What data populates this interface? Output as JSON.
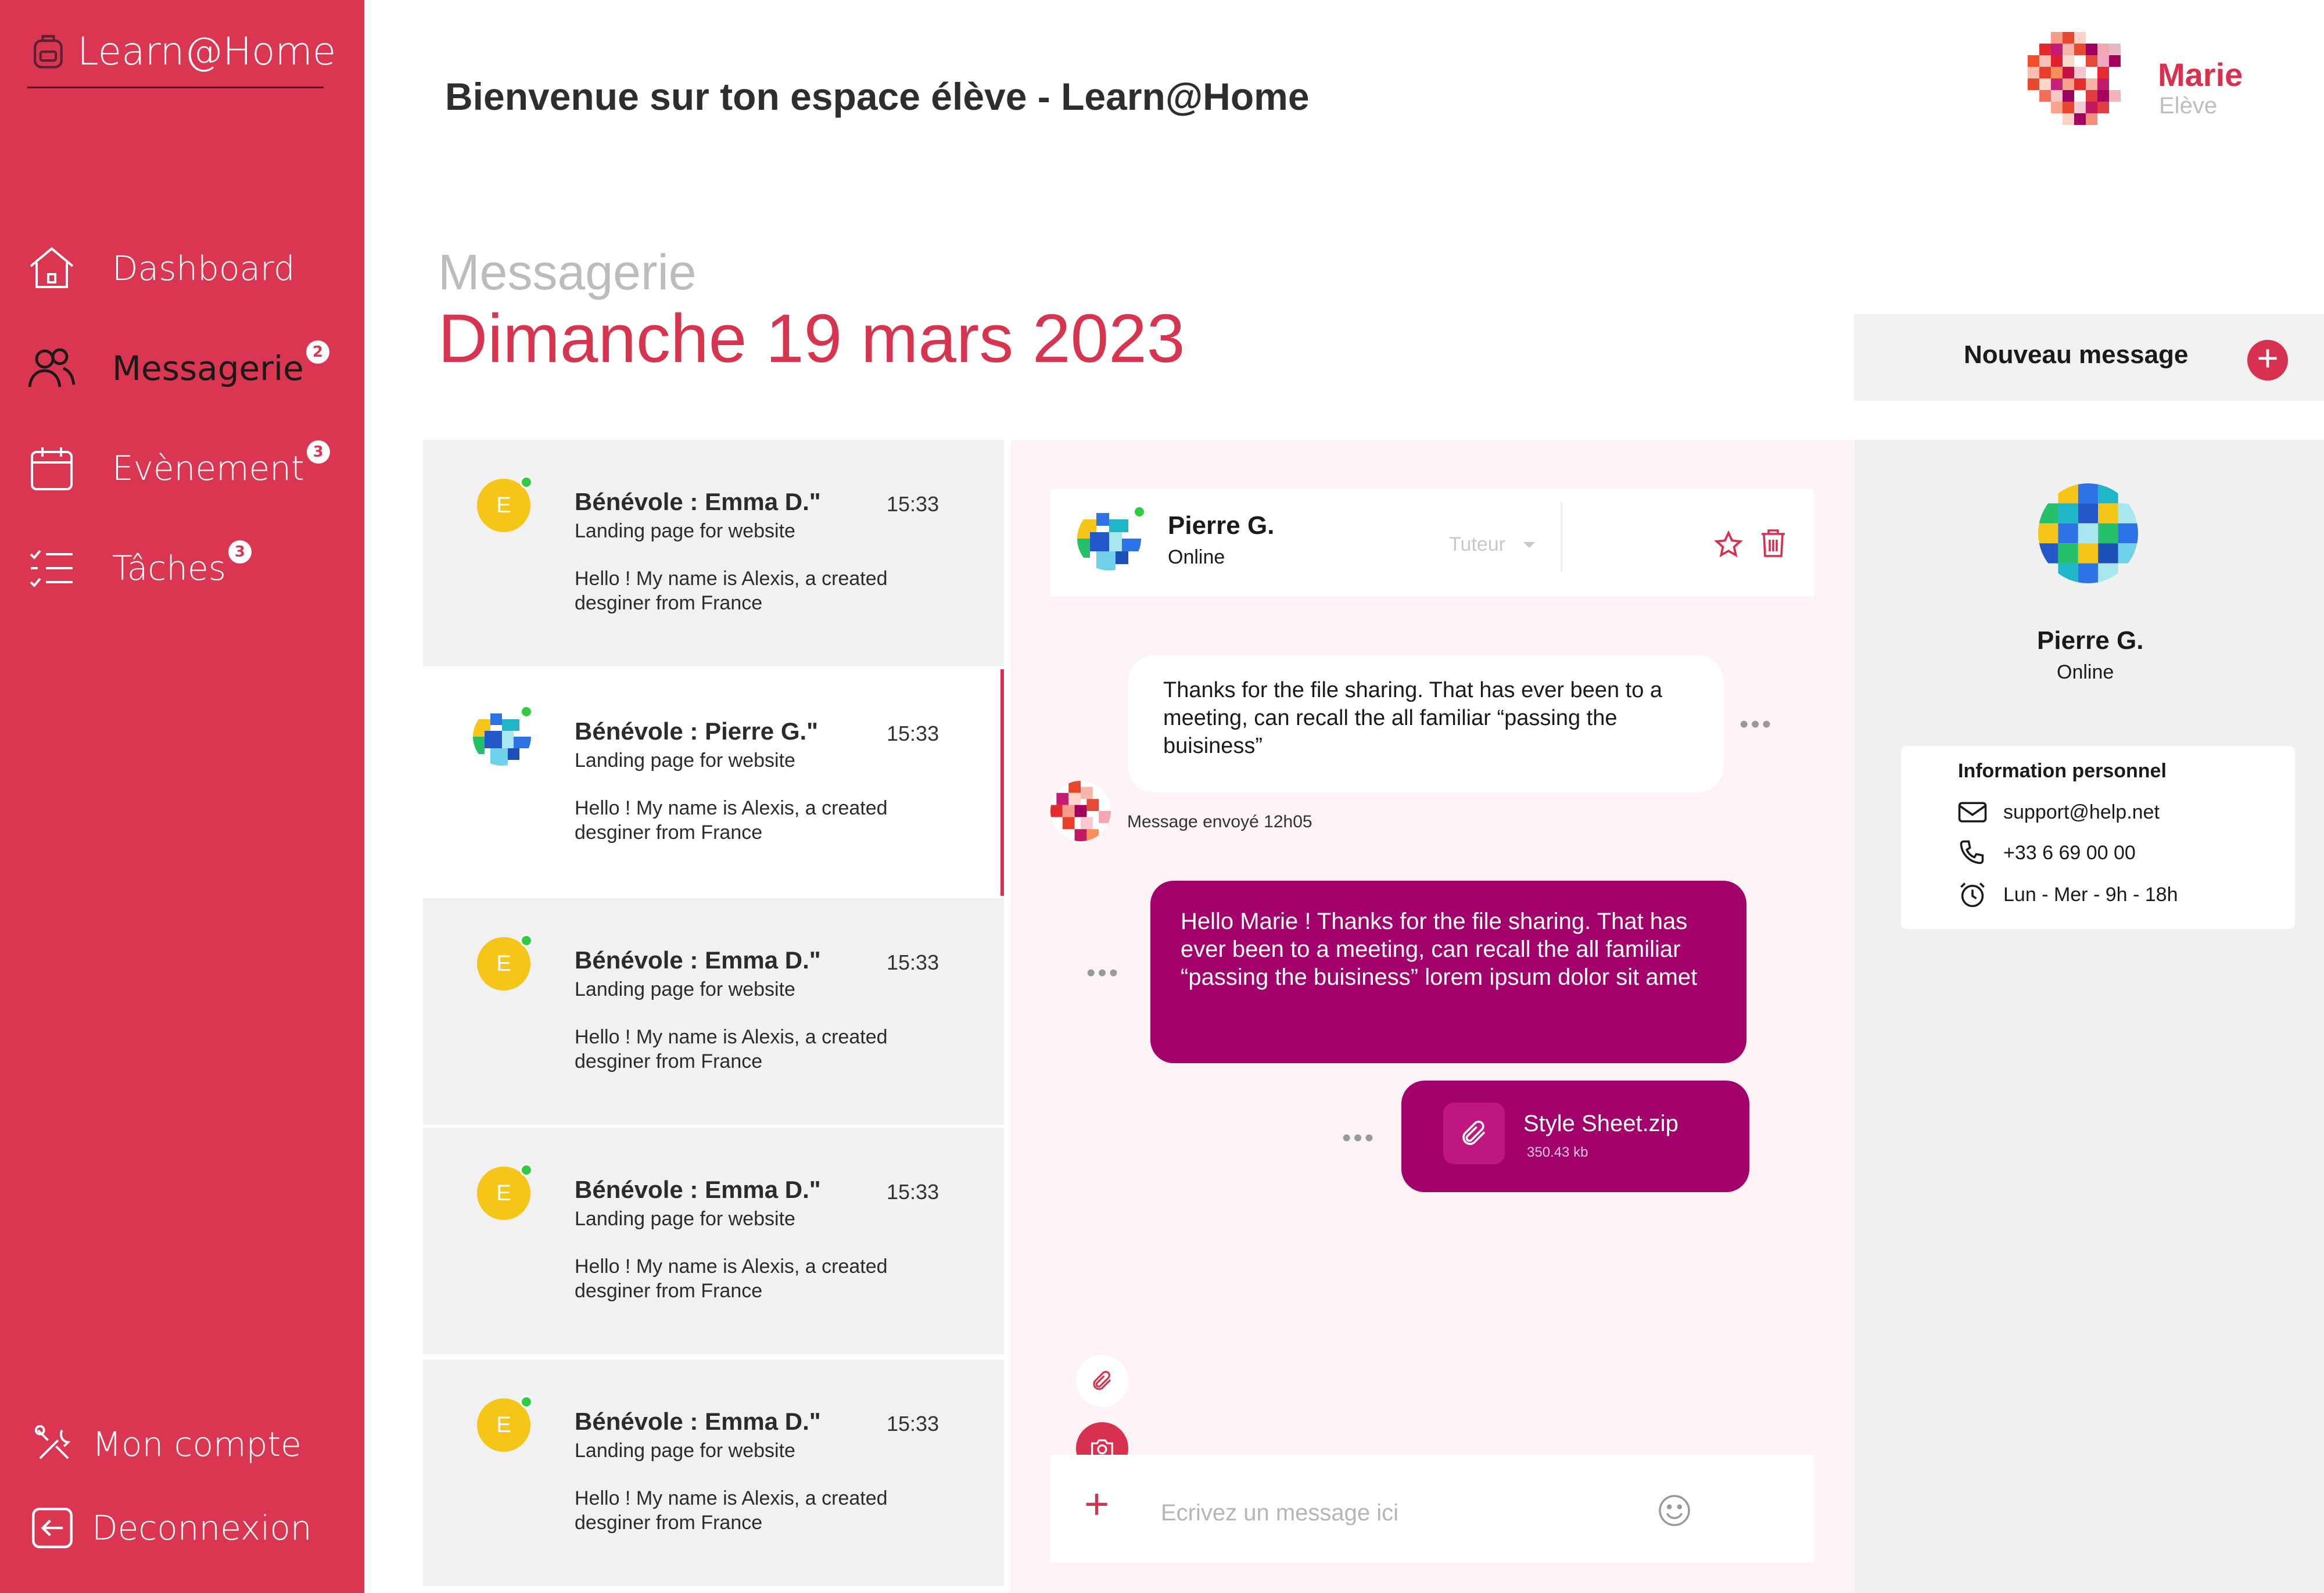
{
  "sidebar": {
    "brand": "Learn@Home",
    "items": [
      {
        "label": "Dashboard",
        "badge": ""
      },
      {
        "label": "Messagerie",
        "badge": "2"
      },
      {
        "label": "Evènement",
        "badge": "3"
      },
      {
        "label": "Tâches",
        "badge": "3"
      }
    ],
    "footer": [
      {
        "label": "Mon compte"
      },
      {
        "label": "Deconnexion"
      }
    ]
  },
  "header": {
    "title": "Bienvenue sur ton espace élève - Learn@Home",
    "user_name": "Marie",
    "user_role": "Elève"
  },
  "page": {
    "section": "Messagerie",
    "date": "Dimanche 19 mars 2023",
    "new_message": "Nouveau message"
  },
  "conversations": [
    {
      "initial": "E",
      "name": "Bénévole : Emma D.\"",
      "time": "15:33",
      "subject": "Landing page for website",
      "preview": "Hello ! My name is Alexis, a created desginer from France"
    },
    {
      "initial": "",
      "name": "Bénévole : Pierre G.\"",
      "time": "15:33",
      "subject": "Landing page for website",
      "preview": "Hello ! My name is Alexis, a created desginer from France"
    },
    {
      "initial": "E",
      "name": "Bénévole : Emma D.\"",
      "time": "15:33",
      "subject": "Landing page for website",
      "preview": "Hello ! My name is Alexis, a created desginer from France"
    },
    {
      "initial": "E",
      "name": "Bénévole : Emma D.\"",
      "time": "15:33",
      "subject": "Landing page for website",
      "preview": "Hello ! My name is Alexis, a created desginer from France"
    },
    {
      "initial": "E",
      "name": "Bénévole : Emma D.\"",
      "time": "15:33",
      "subject": "Landing page for website",
      "preview": "Hello ! My name is Alexis, a created desginer from France"
    }
  ],
  "chat": {
    "contact_name": "Pierre G.",
    "contact_status": "Online",
    "role_select": "Tuteur",
    "incoming": "Thanks for the file sharing. That has ever been to a meeting, can recall the all familiar “passing the buisiness”",
    "sent_info": "Message envoyé 12h05",
    "outgoing": "Hello Marie ! Thanks for the file sharing. That has ever been to a meeting, can recall the all familiar “passing the buisiness” lorem ipsum dolor sit amet",
    "file_name": "Style Sheet.zip",
    "file_size": "350.43 kb",
    "input_placeholder": "Ecrivez un message ici"
  },
  "profile": {
    "name": "Pierre G.",
    "status": "Online",
    "info_title": "Information personnel",
    "email": "support@help.net",
    "phone": "+33 6 69 00 00",
    "hours": "Lun - Mer - 9h - 18h"
  },
  "colors": {
    "primary": "#da3651",
    "accent": "#a2006b",
    "online": "#2ecc40",
    "avatar_yellow": "#f5c518"
  },
  "icons": {
    "brand": "backpack-icon",
    "dashboard": "home-icon",
    "messagerie": "users-icon",
    "evenement": "calendar-icon",
    "taches": "checklist-icon",
    "compte": "tools-icon",
    "deconnexion": "logout-icon"
  }
}
